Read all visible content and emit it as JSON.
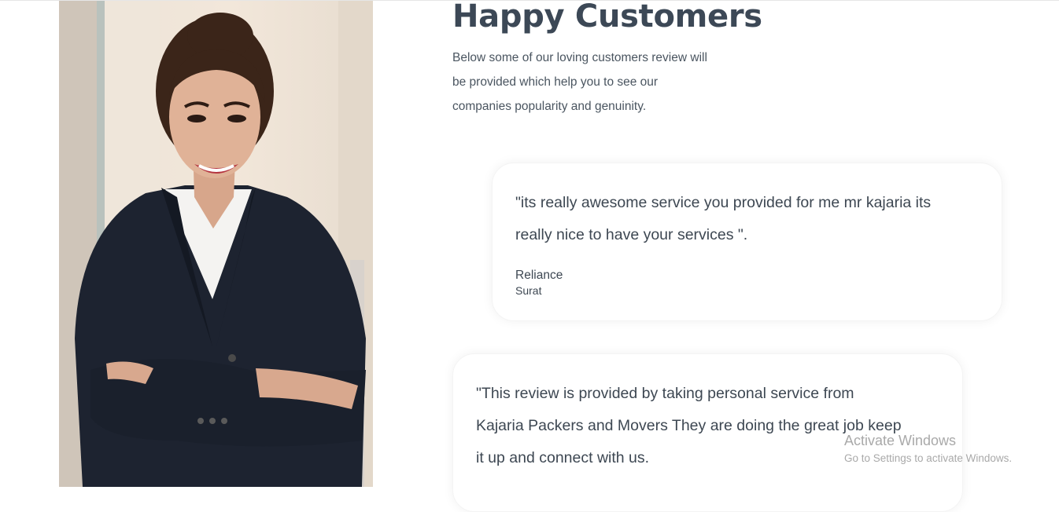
{
  "section": {
    "title": "Happy Customers",
    "intro_lines": [
      "Below some of our loving customers review will",
      "be provided which help you to see our",
      "companies popularity and genuinity."
    ]
  },
  "testimonials": [
    {
      "quote_lines": [
        "\"its really awesome service you provided for me mr kajaria its",
        "really nice to have your services \"."
      ],
      "name": "Reliance",
      "city": "Surat"
    },
    {
      "quote_lines": [
        "\"This review is provided by taking personal service from",
        "Kajaria Packers and Movers They are doing the great job keep",
        "it up and connect with us."
      ]
    }
  ],
  "watermark": {
    "title": "Activate Windows",
    "subtitle": "Go to Settings to activate Windows."
  }
}
